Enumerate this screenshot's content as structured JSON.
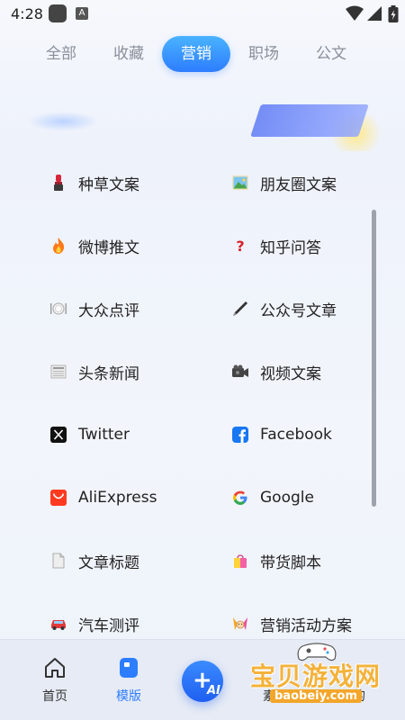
{
  "status_bar": {
    "time": "4:28",
    "app_icon_2_glyph": "A"
  },
  "tabs": [
    {
      "label": "全部",
      "active": false
    },
    {
      "label": "收藏",
      "active": false
    },
    {
      "label": "营销",
      "active": true
    },
    {
      "label": "职场",
      "active": false
    },
    {
      "label": "公文",
      "active": false
    }
  ],
  "templates": [
    {
      "label": "种草文案",
      "icon": "lipstick-icon"
    },
    {
      "label": "朋友圈文案",
      "icon": "landscape-photo-icon"
    },
    {
      "label": "微博推文",
      "icon": "fire-icon"
    },
    {
      "label": "知乎问答",
      "icon": "question-mark-icon"
    },
    {
      "label": "大众点评",
      "icon": "plate-cutlery-icon"
    },
    {
      "label": "公众号文章",
      "icon": "pen-icon"
    },
    {
      "label": "头条新闻",
      "icon": "newspaper-icon"
    },
    {
      "label": "视频文案",
      "icon": "video-camera-icon"
    },
    {
      "label": "Twitter",
      "icon": "x-logo-icon"
    },
    {
      "label": "Facebook",
      "icon": "facebook-logo-icon"
    },
    {
      "label": "AliExpress",
      "icon": "aliexpress-logo-icon"
    },
    {
      "label": "Google",
      "icon": "google-logo-icon"
    },
    {
      "label": "文章标题",
      "icon": "document-icon"
    },
    {
      "label": "带货脚本",
      "icon": "shopping-bag-icon"
    },
    {
      "label": "汽车测评",
      "icon": "car-icon"
    },
    {
      "label": "营销活动方案",
      "icon": "party-icon"
    }
  ],
  "bottom_nav": {
    "home_label": "首页",
    "templates_label": "模版",
    "fab_plus": "+",
    "fab_ai": "AI",
    "partial_label_left": "素",
    "partial_label_right": "的"
  },
  "watermark": {
    "title": "宝贝游戏网",
    "url": "baobeiy.com"
  },
  "colors": {
    "accent": "#2d7dff",
    "tab_inactive": "#8a8f99",
    "text": "#222222",
    "watermark": "#f4b23a"
  }
}
